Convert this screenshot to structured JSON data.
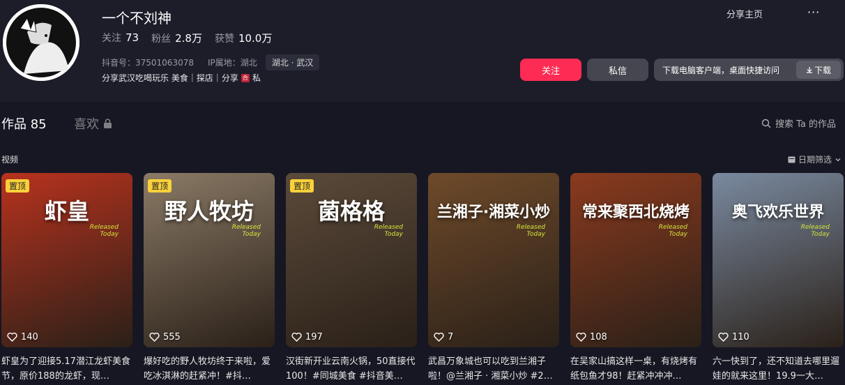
{
  "profile": {
    "nickname": "一个不刘神",
    "stats": [
      {
        "label": "关注",
        "value": "73"
      },
      {
        "label": "粉丝",
        "value": "2.8万"
      },
      {
        "label": "获赞",
        "value": "10.0万"
      }
    ],
    "douyin_id": "抖音号：37501063078",
    "ip_location": "IP属地：湖北",
    "location_tag": "湖北 · 武汉",
    "bio": "分享武汉吃喝玩乐 美食｜探店｜分享",
    "bio_badge_text": "合",
    "bio_tail": "私"
  },
  "header_actions": {
    "share_home": "分享主页",
    "more": "···",
    "follow": "关注",
    "message": "私信",
    "download_promo": "下载电脑客户端，桌面快捷访问",
    "download_button": "下载"
  },
  "tabs": {
    "works_label": "作品",
    "works_count": "85",
    "likes_label": "喜欢"
  },
  "search": {
    "label": "搜索 Ta 的作品"
  },
  "section": {
    "label": "视频",
    "date_filter": "日期筛选"
  },
  "videos": [
    {
      "title": "虾皇",
      "pinned": "置顶",
      "likes": "140",
      "caption": "虾皇为了迎接5.17潜江龙虾美食节，原价188的龙虾，现…",
      "bg": "#b8321e"
    },
    {
      "title": "野人牧坊",
      "pinned": "置顶",
      "likes": "555",
      "caption": "爆好吃的野人牧坊终于来啦，爱吃冰淇淋的赶紧冲！#抖…",
      "bg": "#8a7a66"
    },
    {
      "title": "菌格格",
      "pinned": "置顶",
      "likes": "197",
      "caption": "汉街新开业云南火锅，50直接代100！#同城美食 #抖音美…",
      "bg": "#5b4a3a"
    },
    {
      "title": "兰湘子·湘菜小炒",
      "pinned": "",
      "likes": "7",
      "caption": "武昌万象城也可以吃到兰湘子啦！@兰湘子 · 湘菜小炒 #2…",
      "bg": "#6e4a2a"
    },
    {
      "title": "常来聚西北烧烤",
      "pinned": "",
      "likes": "108",
      "caption": "在吴家山搞这样一桌，有烧烤有纸包鱼才98！赶紧冲冲冲…",
      "bg": "#8a3a1e"
    },
    {
      "title": "奥飞欢乐世界",
      "pinned": "",
      "likes": "110",
      "caption": "六一快到了，还不知道去哪里遛娃的就来这里！19.9一大…",
      "bg": "#7a8aa0"
    }
  ],
  "thumb_overlay": {
    "released": "Released",
    "today": "Today"
  },
  "colors": {
    "accent": "#fe2c55",
    "pin": "#f9d13a",
    "background": "#161722"
  }
}
